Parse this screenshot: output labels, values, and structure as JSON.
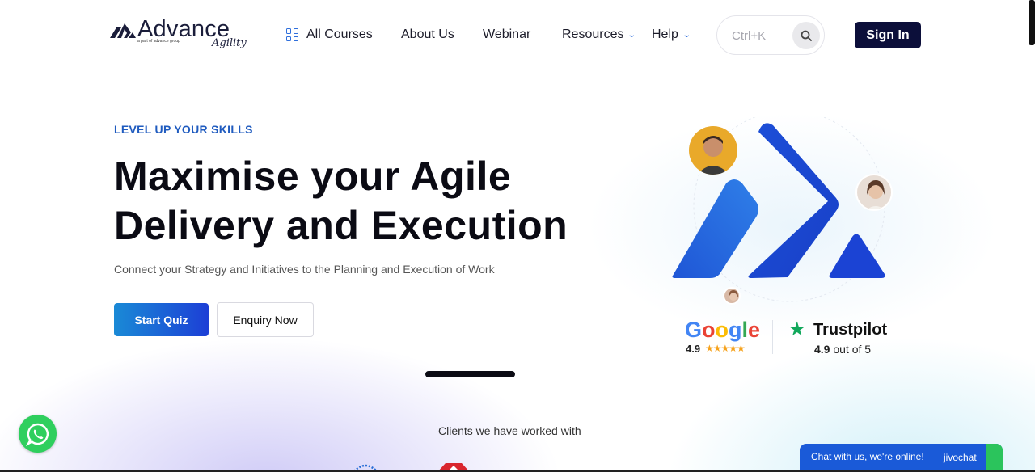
{
  "brand": {
    "name": "Advance",
    "tagline": "a part of advance group",
    "script": "Agility"
  },
  "nav": {
    "all_courses": "All Courses",
    "about_us": "About Us",
    "webinar": "Webinar",
    "resources": "Resources",
    "help": "Help"
  },
  "search": {
    "placeholder": "Ctrl+K"
  },
  "header": {
    "sign_in": "Sign In"
  },
  "hero": {
    "eyebrow": "LEVEL UP YOUR SKILLS",
    "headline_line1": "Maximise your Agile",
    "headline_line2": "Delivery and Execution",
    "subline": "Connect your Strategy and Initiatives to the Planning and Execution of Work",
    "start_quiz": "Start Quiz",
    "enquiry_now": "Enquiry Now",
    "carousel_progress": 0.5
  },
  "ratings": {
    "google": {
      "letters": [
        "G",
        "o",
        "o",
        "g",
        "l",
        "e"
      ],
      "score": "4.9",
      "stars": "★★★★★"
    },
    "trustpilot": {
      "name": "Trustpilot",
      "score": "4.9",
      "suffix": " out of 5"
    }
  },
  "clients": {
    "heading": "Clients we have worked with"
  },
  "chat": {
    "text": "Chat with us, we're online!",
    "brand": "jivochat"
  },
  "colors": {
    "brand_blue": "#1c3fd6",
    "navy": "#0c0f3a",
    "google_blue": "#4285F4",
    "google_red": "#EA4335",
    "google_yellow": "#FBBC05",
    "google_green": "#34A853",
    "trustpilot_green": "#11a85b",
    "whatsapp_green": "#2fcf5e",
    "star_orange": "#f6a21c"
  },
  "icons": {
    "courses": "grid-icon",
    "search": "search-icon",
    "chevron": "chevron-down-icon",
    "whatsapp": "whatsapp-icon",
    "trustpilot": "star-icon"
  }
}
